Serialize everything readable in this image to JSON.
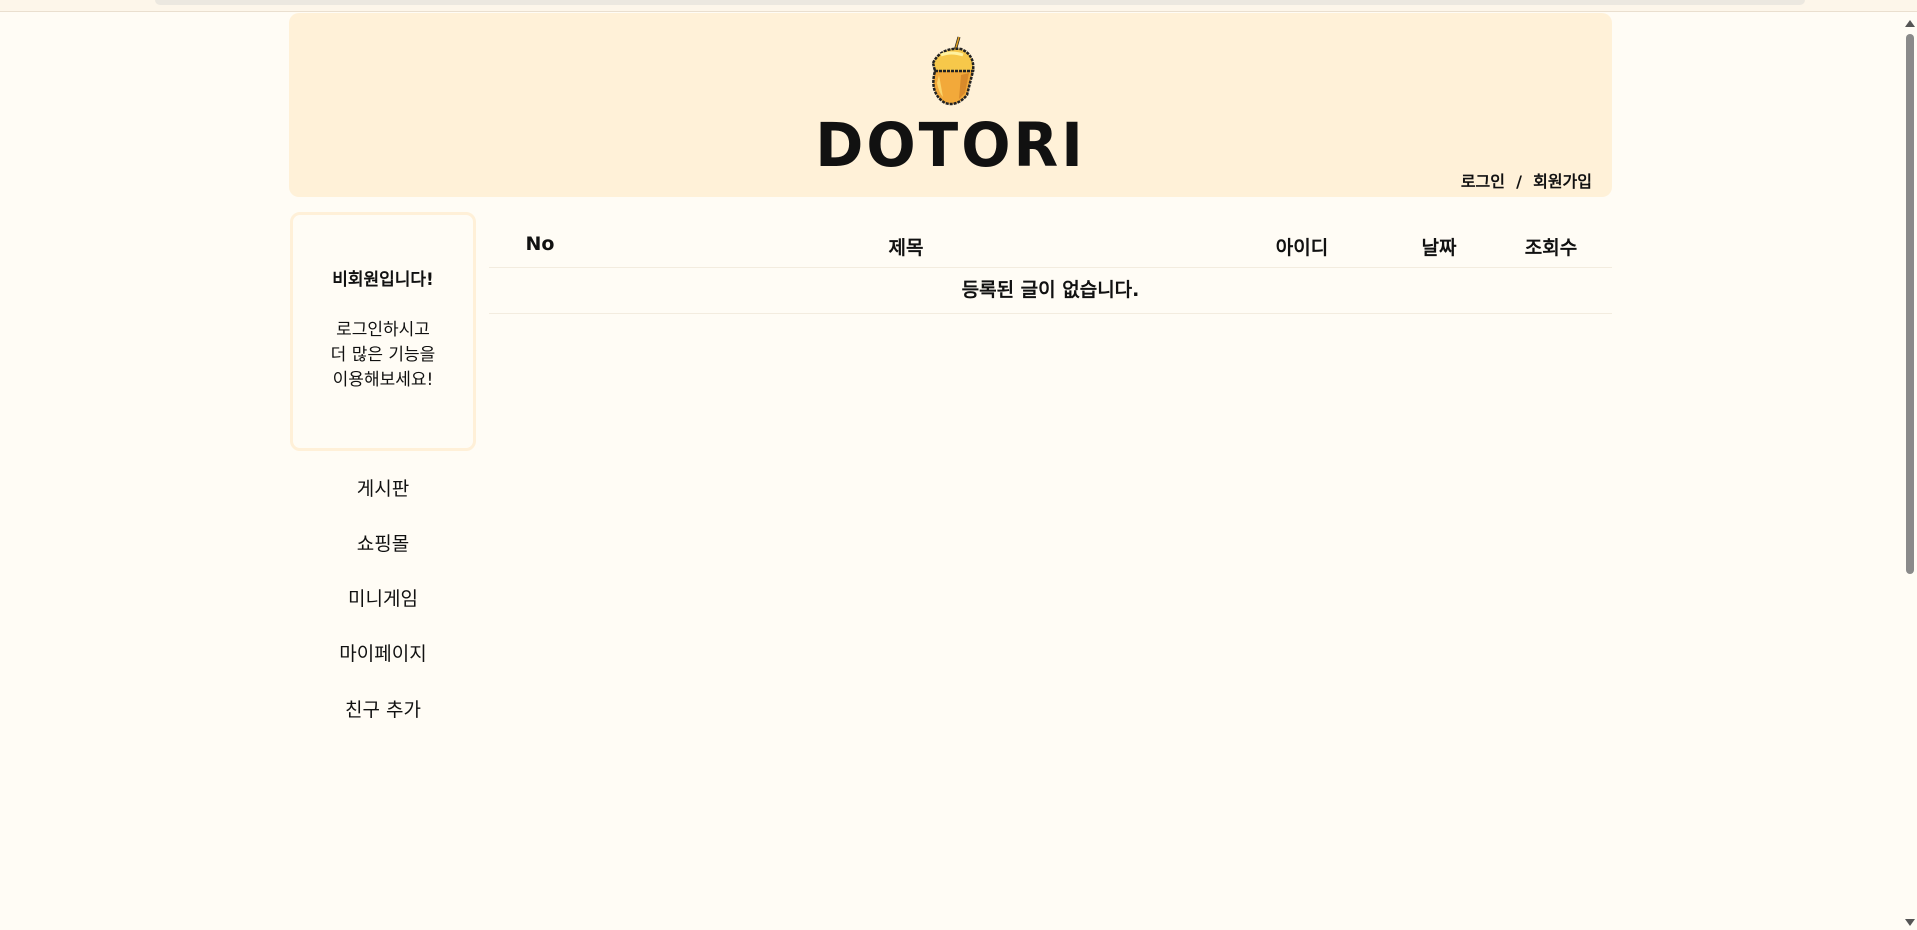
{
  "header": {
    "logo": "DOTORI",
    "login": "로그인",
    "separator": "/",
    "signup": "회원가입"
  },
  "sidebar": {
    "guest_title": "비회원입니다!",
    "guest_message": "로그인하시고\n더 많은 기능을\n이용해보세요!",
    "items": [
      {
        "label": "게시판"
      },
      {
        "label": "쇼핑몰"
      },
      {
        "label": "미니게임"
      },
      {
        "label": "마이페이지"
      },
      {
        "label": "친구 추가"
      }
    ]
  },
  "table": {
    "columns": [
      "No",
      "제목",
      "아이디",
      "날짜",
      "조회수"
    ],
    "empty_message": "등록된 글이 없습니다."
  },
  "colors": {
    "header_bg": "#fff1d8",
    "page_bg": "#fffcf5",
    "acorn": "#f5b73b"
  }
}
